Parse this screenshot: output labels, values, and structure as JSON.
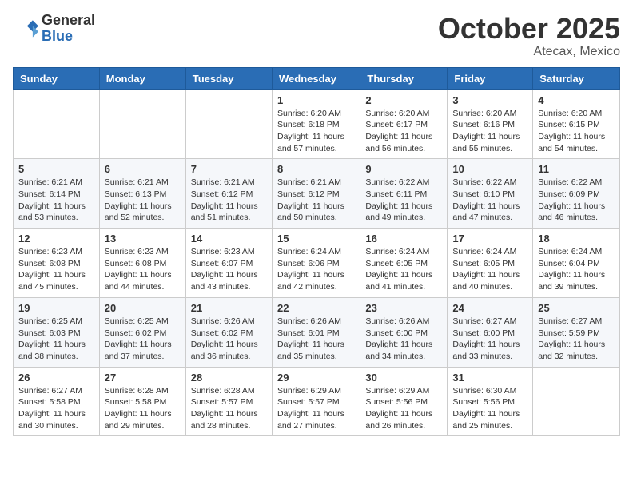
{
  "header": {
    "logo_line1": "General",
    "logo_line2": "Blue",
    "month": "October 2025",
    "location": "Atecax, Mexico"
  },
  "weekdays": [
    "Sunday",
    "Monday",
    "Tuesday",
    "Wednesday",
    "Thursday",
    "Friday",
    "Saturday"
  ],
  "weeks": [
    [
      {
        "day": "",
        "info": ""
      },
      {
        "day": "",
        "info": ""
      },
      {
        "day": "",
        "info": ""
      },
      {
        "day": "1",
        "info": "Sunrise: 6:20 AM\nSunset: 6:18 PM\nDaylight: 11 hours and 57 minutes."
      },
      {
        "day": "2",
        "info": "Sunrise: 6:20 AM\nSunset: 6:17 PM\nDaylight: 11 hours and 56 minutes."
      },
      {
        "day": "3",
        "info": "Sunrise: 6:20 AM\nSunset: 6:16 PM\nDaylight: 11 hours and 55 minutes."
      },
      {
        "day": "4",
        "info": "Sunrise: 6:20 AM\nSunset: 6:15 PM\nDaylight: 11 hours and 54 minutes."
      }
    ],
    [
      {
        "day": "5",
        "info": "Sunrise: 6:21 AM\nSunset: 6:14 PM\nDaylight: 11 hours and 53 minutes."
      },
      {
        "day": "6",
        "info": "Sunrise: 6:21 AM\nSunset: 6:13 PM\nDaylight: 11 hours and 52 minutes."
      },
      {
        "day": "7",
        "info": "Sunrise: 6:21 AM\nSunset: 6:12 PM\nDaylight: 11 hours and 51 minutes."
      },
      {
        "day": "8",
        "info": "Sunrise: 6:21 AM\nSunset: 6:12 PM\nDaylight: 11 hours and 50 minutes."
      },
      {
        "day": "9",
        "info": "Sunrise: 6:22 AM\nSunset: 6:11 PM\nDaylight: 11 hours and 49 minutes."
      },
      {
        "day": "10",
        "info": "Sunrise: 6:22 AM\nSunset: 6:10 PM\nDaylight: 11 hours and 47 minutes."
      },
      {
        "day": "11",
        "info": "Sunrise: 6:22 AM\nSunset: 6:09 PM\nDaylight: 11 hours and 46 minutes."
      }
    ],
    [
      {
        "day": "12",
        "info": "Sunrise: 6:23 AM\nSunset: 6:08 PM\nDaylight: 11 hours and 45 minutes."
      },
      {
        "day": "13",
        "info": "Sunrise: 6:23 AM\nSunset: 6:08 PM\nDaylight: 11 hours and 44 minutes."
      },
      {
        "day": "14",
        "info": "Sunrise: 6:23 AM\nSunset: 6:07 PM\nDaylight: 11 hours and 43 minutes."
      },
      {
        "day": "15",
        "info": "Sunrise: 6:24 AM\nSunset: 6:06 PM\nDaylight: 11 hours and 42 minutes."
      },
      {
        "day": "16",
        "info": "Sunrise: 6:24 AM\nSunset: 6:05 PM\nDaylight: 11 hours and 41 minutes."
      },
      {
        "day": "17",
        "info": "Sunrise: 6:24 AM\nSunset: 6:05 PM\nDaylight: 11 hours and 40 minutes."
      },
      {
        "day": "18",
        "info": "Sunrise: 6:24 AM\nSunset: 6:04 PM\nDaylight: 11 hours and 39 minutes."
      }
    ],
    [
      {
        "day": "19",
        "info": "Sunrise: 6:25 AM\nSunset: 6:03 PM\nDaylight: 11 hours and 38 minutes."
      },
      {
        "day": "20",
        "info": "Sunrise: 6:25 AM\nSunset: 6:02 PM\nDaylight: 11 hours and 37 minutes."
      },
      {
        "day": "21",
        "info": "Sunrise: 6:26 AM\nSunset: 6:02 PM\nDaylight: 11 hours and 36 minutes."
      },
      {
        "day": "22",
        "info": "Sunrise: 6:26 AM\nSunset: 6:01 PM\nDaylight: 11 hours and 35 minutes."
      },
      {
        "day": "23",
        "info": "Sunrise: 6:26 AM\nSunset: 6:00 PM\nDaylight: 11 hours and 34 minutes."
      },
      {
        "day": "24",
        "info": "Sunrise: 6:27 AM\nSunset: 6:00 PM\nDaylight: 11 hours and 33 minutes."
      },
      {
        "day": "25",
        "info": "Sunrise: 6:27 AM\nSunset: 5:59 PM\nDaylight: 11 hours and 32 minutes."
      }
    ],
    [
      {
        "day": "26",
        "info": "Sunrise: 6:27 AM\nSunset: 5:58 PM\nDaylight: 11 hours and 30 minutes."
      },
      {
        "day": "27",
        "info": "Sunrise: 6:28 AM\nSunset: 5:58 PM\nDaylight: 11 hours and 29 minutes."
      },
      {
        "day": "28",
        "info": "Sunrise: 6:28 AM\nSunset: 5:57 PM\nDaylight: 11 hours and 28 minutes."
      },
      {
        "day": "29",
        "info": "Sunrise: 6:29 AM\nSunset: 5:57 PM\nDaylight: 11 hours and 27 minutes."
      },
      {
        "day": "30",
        "info": "Sunrise: 6:29 AM\nSunset: 5:56 PM\nDaylight: 11 hours and 26 minutes."
      },
      {
        "day": "31",
        "info": "Sunrise: 6:30 AM\nSunset: 5:56 PM\nDaylight: 11 hours and 25 minutes."
      },
      {
        "day": "",
        "info": ""
      }
    ]
  ]
}
